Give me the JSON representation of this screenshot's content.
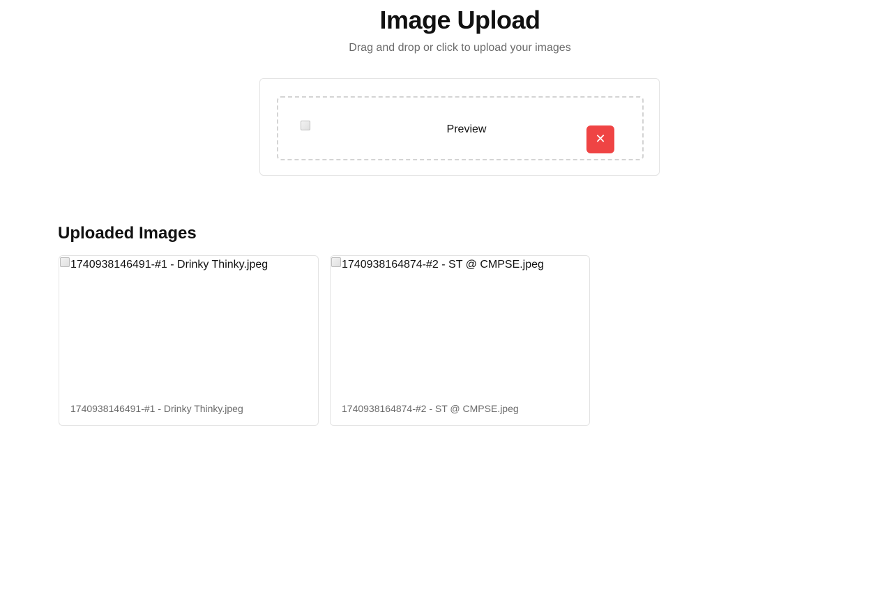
{
  "header": {
    "title": "Image Upload",
    "subtitle": "Drag and drop or click to upload your images"
  },
  "upload": {
    "preview_alt": "Preview",
    "remove_label": "✕"
  },
  "gallery": {
    "title": "Uploaded Images",
    "images": [
      {
        "alt": "1740938146491-#1 - Drinky Thinky.jpeg",
        "caption": "1740938146491-#1 - Drinky Thinky.jpeg"
      },
      {
        "alt": "1740938164874-#2 - ST @ CMPSE.jpeg",
        "caption": "1740938164874-#2 - ST @ CMPSE.jpeg"
      }
    ]
  },
  "colors": {
    "danger": "#ef4444",
    "muted_text": "#6b6b6b",
    "border": "#e3e3e3"
  }
}
